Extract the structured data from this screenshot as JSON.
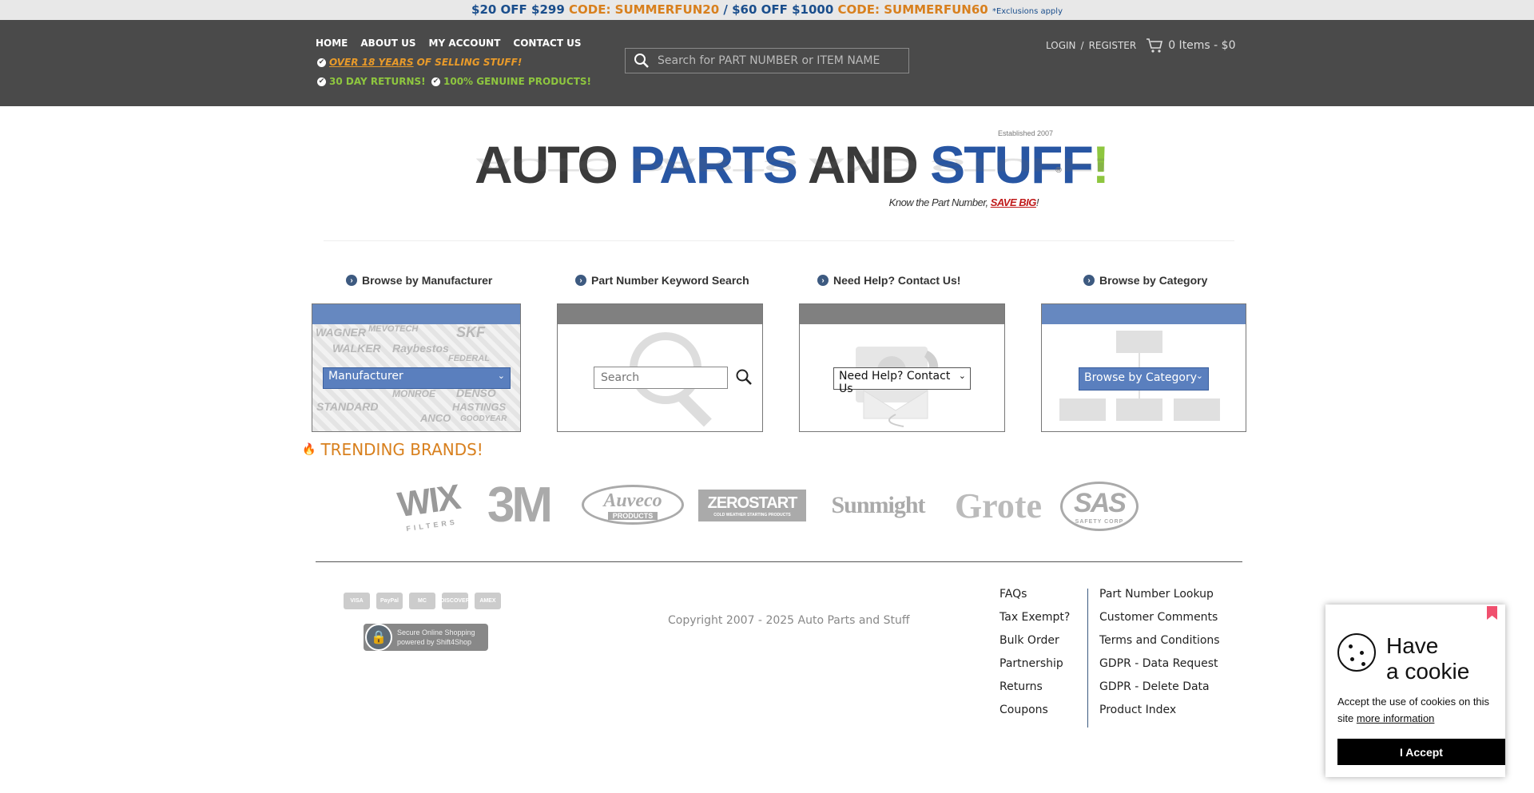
{
  "promo": {
    "part1": "$20 OFF $299",
    "code1": "CODE: SUMMERFUN20",
    "sep": "/",
    "part2": "$60 OFF $1000",
    "code2": "CODE: SUMMERFUN60",
    "exclusions": "*Exclusions apply"
  },
  "nav": {
    "items": [
      "HOME",
      "ABOUT US",
      "MY ACCOUNT",
      "CONTACT US"
    ]
  },
  "taglines": {
    "years_link": "OVER 18 YEARS",
    "years_rest": "OF SELLING STUFF!",
    "returns": "30 DAY RETURNS!",
    "genuine": "100% GENUINE PRODUCTS!"
  },
  "search": {
    "placeholder": "Search for PART NUMBER or ITEM NAME"
  },
  "account": {
    "login": "LOGIN",
    "sep": "/",
    "register": "REGISTER",
    "cart": "0 Items - $0"
  },
  "logo": {
    "word1": "AUTO",
    "word2": "PARTS",
    "word3": "AND",
    "word4": "STUFF",
    "bang": "!",
    "established": "Established 2007",
    "reg": "®",
    "tagline_pre": "Know the Part Number,",
    "tagline_em": "SAVE BIG",
    "tagline_post": "!"
  },
  "columns": {
    "manufacturer": {
      "title": "Browse by Manufacturer",
      "select": "Manufacturer"
    },
    "keyword": {
      "title": "Part Number Keyword Search",
      "placeholder": "Search"
    },
    "help": {
      "title": "Need Help? Contact Us!",
      "select": "Need Help? Contact Us"
    },
    "category": {
      "title": "Browse by Category",
      "select": "Browse by Category"
    }
  },
  "bg_brands": [
    "WAGNER",
    "MEVOTECH",
    "SKF",
    "WALKER",
    "Raybestos",
    "FEDERAL",
    "STANDARD",
    "DENSO",
    "HASTINGS",
    "ANCO",
    "GOODYEAR",
    "MONROE"
  ],
  "trending": {
    "title": "TRENDING BRANDS!",
    "brands": [
      "WIX",
      "3M",
      "Auveco",
      "ZEROSTART",
      "Sunmight",
      "Grote",
      "SAS"
    ],
    "brand_sub": {
      "wix": "FILTERS",
      "auveco": "PRODUCTS",
      "zerostart": "COLD WEATHER STARTING PRODUCTS",
      "sas": "SAFETY CORP"
    }
  },
  "footer": {
    "payments": [
      "VISA",
      "PayPal",
      "MC",
      "DISCOVER",
      "AMEX"
    ],
    "secure_line1": "Secure Online Shopping",
    "secure_line2": "powered by Shift4Shop",
    "copyright": "Copyright 2007 - 2025 Auto Parts and Stuff",
    "links_left": [
      "FAQs",
      "Tax Exempt?",
      "Bulk Order",
      "Partnership",
      "Returns",
      "Coupons"
    ],
    "links_right": [
      "Part Number Lookup",
      "Customer Comments",
      "Terms and Conditions",
      "GDPR - Data Request",
      "GDPR - Delete Data",
      "Product Index"
    ]
  },
  "cookie": {
    "title_line1": "Have",
    "title_line2": "a cookie",
    "message": "Accept the use of cookies on this site",
    "more": "more information",
    "accept": "I Accept"
  },
  "colors": {
    "header_bg": "#4a4a4a",
    "brand_blue": "#2856a3",
    "brand_green": "#8ec63f",
    "accent_orange": "#d8801e"
  }
}
